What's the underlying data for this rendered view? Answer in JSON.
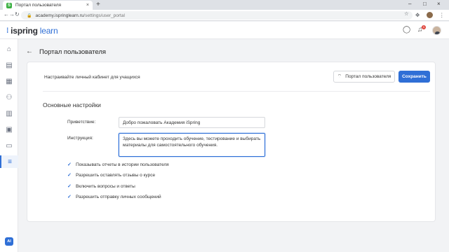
{
  "browser": {
    "tab_title": "Портал пользователя",
    "tab_close": "×",
    "new_tab": "+",
    "favicon": "S",
    "url_host": "academy.ispringlearn.ru",
    "url_path": "/settings/user_portal",
    "back": "←",
    "forward": "→",
    "reload": "↻",
    "lock": "🔒",
    "icons": [
      "star-icon",
      "extensions-icon",
      "profile-icon",
      "menu-icon"
    ],
    "window_controls": [
      "–",
      "□",
      "×"
    ]
  },
  "app": {
    "logo_text": "ispring",
    "logo_suffix": "learn",
    "brand_color": "#2f6fd6",
    "notifications_count": "1"
  },
  "sidebar": {
    "items": [
      {
        "icon": "home-icon",
        "glyph": "⌂"
      },
      {
        "icon": "courses-icon",
        "glyph": "▤"
      },
      {
        "icon": "calendar-icon",
        "glyph": "▦"
      },
      {
        "icon": "users-icon",
        "glyph": "⚇"
      },
      {
        "icon": "reports-icon",
        "glyph": "▥"
      },
      {
        "icon": "catalog-icon",
        "glyph": "▣"
      },
      {
        "icon": "messages-icon",
        "glyph": "▭"
      },
      {
        "icon": "settings-icon",
        "glyph": "≡",
        "active": true
      }
    ],
    "ai_label": "AI"
  },
  "page": {
    "title": "Портал пользователя",
    "description": "Настраивайте личный кабинет для учащихся",
    "portal_button": "Портал пользователя",
    "save_button": "Сохранить",
    "section_title": "Основные настройки",
    "greeting_label": "Приветствие:",
    "greeting_value": "Добро пожаловать Академия iSpring",
    "instruction_label": "Инструкция:",
    "instruction_value": "Здесь вы можете проходить обучение, тестирование и выбирать материалы для самостоятельного обучения.",
    "checkboxes": [
      {
        "label": "Показывать отчеты в истории пользователя",
        "checked": true
      },
      {
        "label": "Разрешить оставлять отзывы о курсе",
        "checked": true
      },
      {
        "label": "Включить вопросы и ответы",
        "checked": true
      },
      {
        "label": "Разрешить отправку личных сообщений",
        "checked": true
      }
    ],
    "check_glyph": "✓"
  }
}
